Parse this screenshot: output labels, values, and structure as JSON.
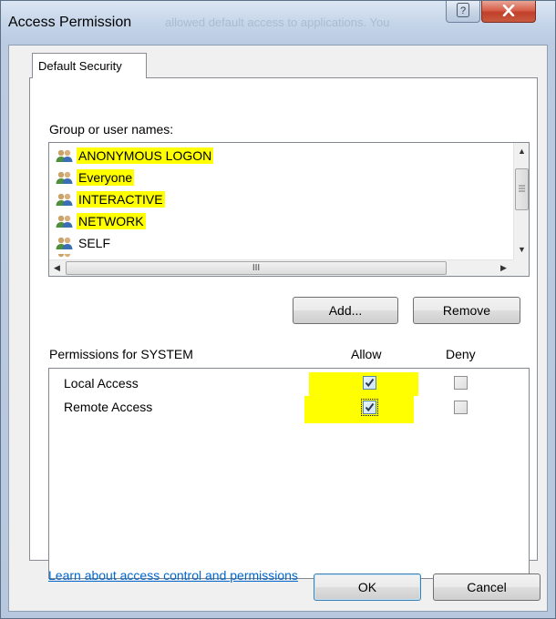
{
  "window": {
    "title": "Access Permission",
    "ghost_text": "allowed default access to applications. You"
  },
  "tab": {
    "label": "Default Security"
  },
  "group_section": {
    "label": "Group or user names:",
    "users": [
      {
        "name": "ANONYMOUS LOGON",
        "highlighted": true
      },
      {
        "name": "Everyone",
        "highlighted": true
      },
      {
        "name": "INTERACTIVE",
        "highlighted": true
      },
      {
        "name": "NETWORK",
        "highlighted": true
      },
      {
        "name": "SELF",
        "highlighted": false
      }
    ],
    "hscroll_grip": "III"
  },
  "buttons": {
    "add": "Add...",
    "remove": "Remove",
    "ok": "OK",
    "cancel": "Cancel"
  },
  "permissions": {
    "label": "Permissions for SYSTEM",
    "allow_header": "Allow",
    "deny_header": "Deny",
    "rows": [
      {
        "name": "Local Access",
        "allow": true,
        "deny": false
      },
      {
        "name": "Remote Access",
        "allow": true,
        "deny": false
      }
    ]
  },
  "link": {
    "text": "Learn about access control and permissions"
  },
  "colors": {
    "highlight": "#ffff00",
    "link": "#0066cc",
    "close_button": "#c85a40"
  }
}
